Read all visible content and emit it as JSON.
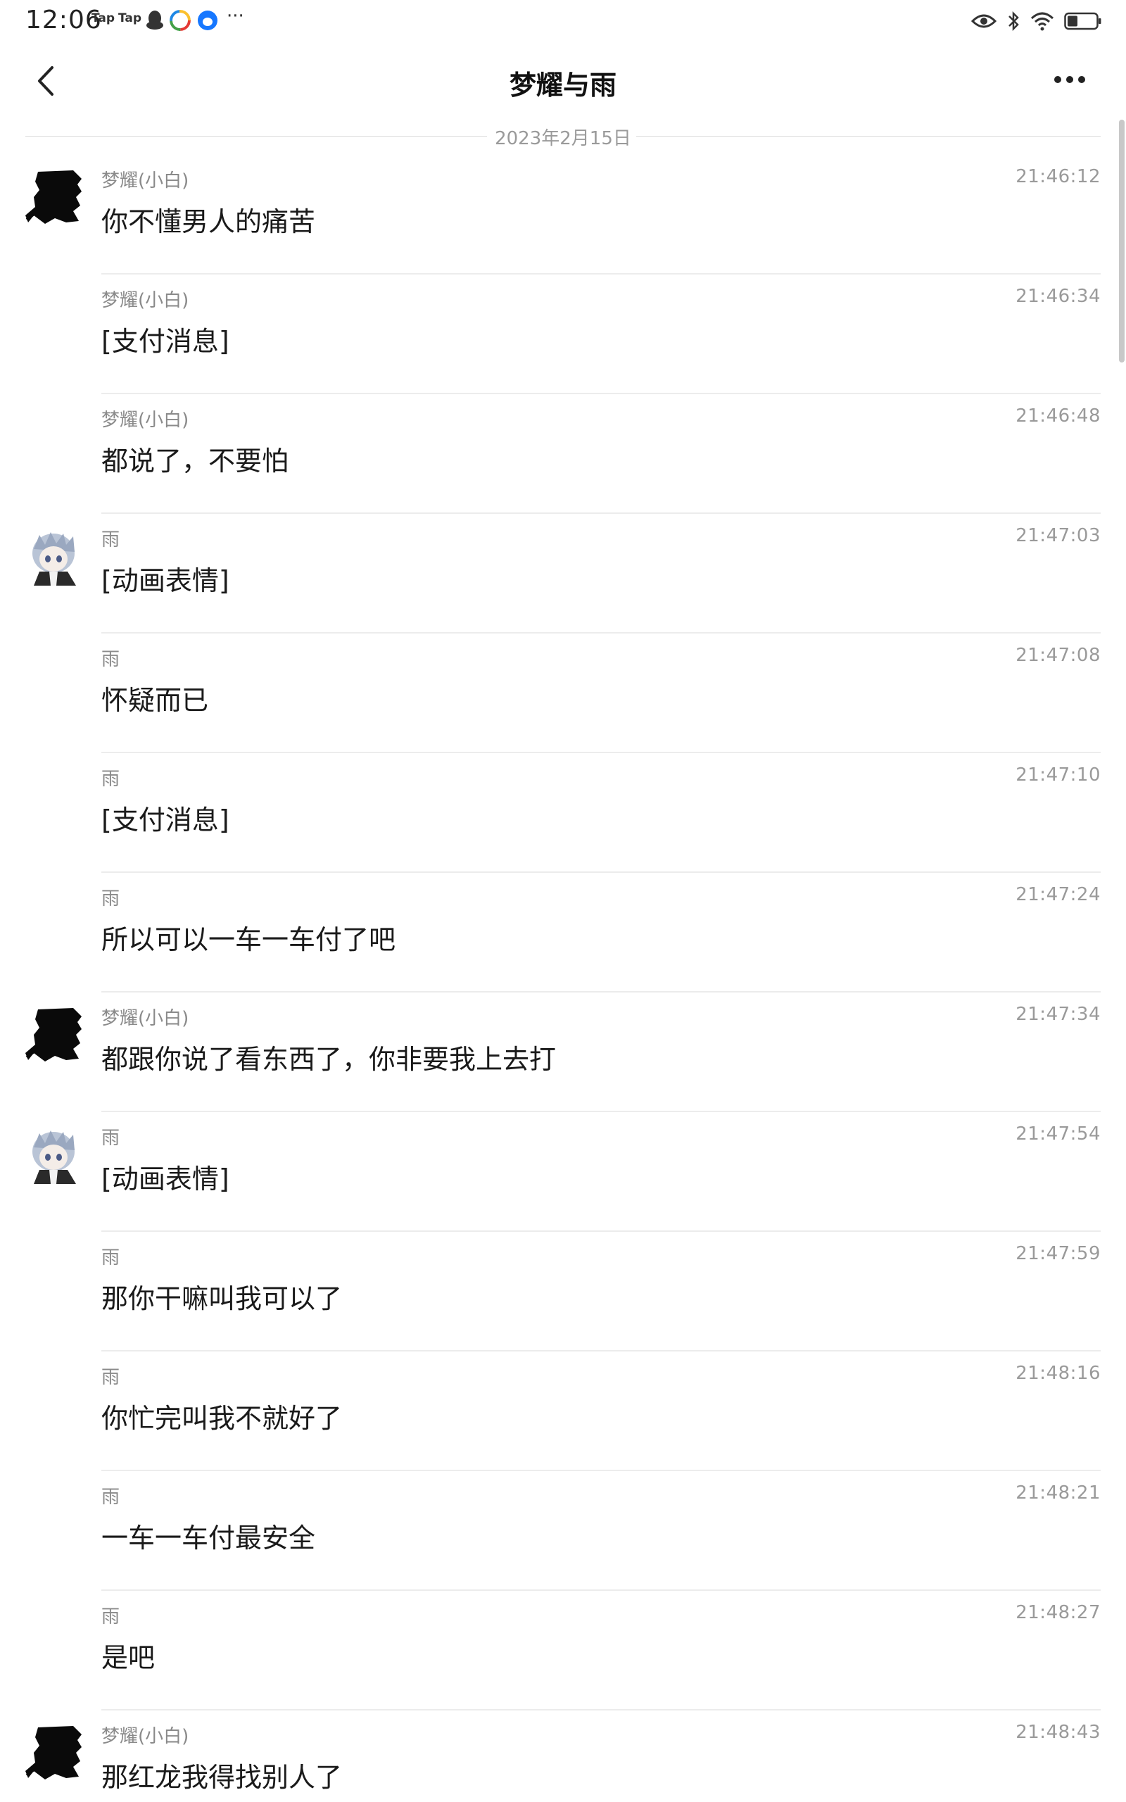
{
  "status_bar": {
    "time": "12:06",
    "apps": [
      "Tap",
      "Tap"
    ]
  },
  "header": {
    "title": "梦耀与雨"
  },
  "date_separator": "2023年2月15日",
  "messages": [
    {
      "sender": "梦耀(小白)",
      "time": "21:46:12",
      "text": "你不懂男人的痛苦",
      "avatar": "silhouette"
    },
    {
      "sender": "梦耀(小白)",
      "time": "21:46:34",
      "text": "[支付消息]",
      "avatar": ""
    },
    {
      "sender": "梦耀(小白)",
      "time": "21:46:48",
      "text": "都说了，不要怕",
      "avatar": ""
    },
    {
      "sender": "雨",
      "time": "21:47:03",
      "text": "[动画表情]",
      "avatar": "anime"
    },
    {
      "sender": "雨",
      "time": "21:47:08",
      "text": "怀疑而已",
      "avatar": ""
    },
    {
      "sender": "雨",
      "time": "21:47:10",
      "text": "[支付消息]",
      "avatar": ""
    },
    {
      "sender": "雨",
      "time": "21:47:24",
      "text": "所以可以一车一车付了吧",
      "avatar": ""
    },
    {
      "sender": "梦耀(小白)",
      "time": "21:47:34",
      "text": "都跟你说了看东西了，你非要我上去打",
      "avatar": "silhouette"
    },
    {
      "sender": "雨",
      "time": "21:47:54",
      "text": "[动画表情]",
      "avatar": "anime"
    },
    {
      "sender": "雨",
      "time": "21:47:59",
      "text": "那你干嘛叫我可以了",
      "avatar": ""
    },
    {
      "sender": "雨",
      "time": "21:48:16",
      "text": "你忙完叫我不就好了",
      "avatar": ""
    },
    {
      "sender": "雨",
      "time": "21:48:21",
      "text": "一车一车付最安全",
      "avatar": ""
    },
    {
      "sender": "雨",
      "time": "21:48:27",
      "text": "是吧",
      "avatar": ""
    },
    {
      "sender": "梦耀(小白)",
      "time": "21:48:43",
      "text": "那红龙我得找别人了",
      "avatar": "silhouette"
    }
  ]
}
